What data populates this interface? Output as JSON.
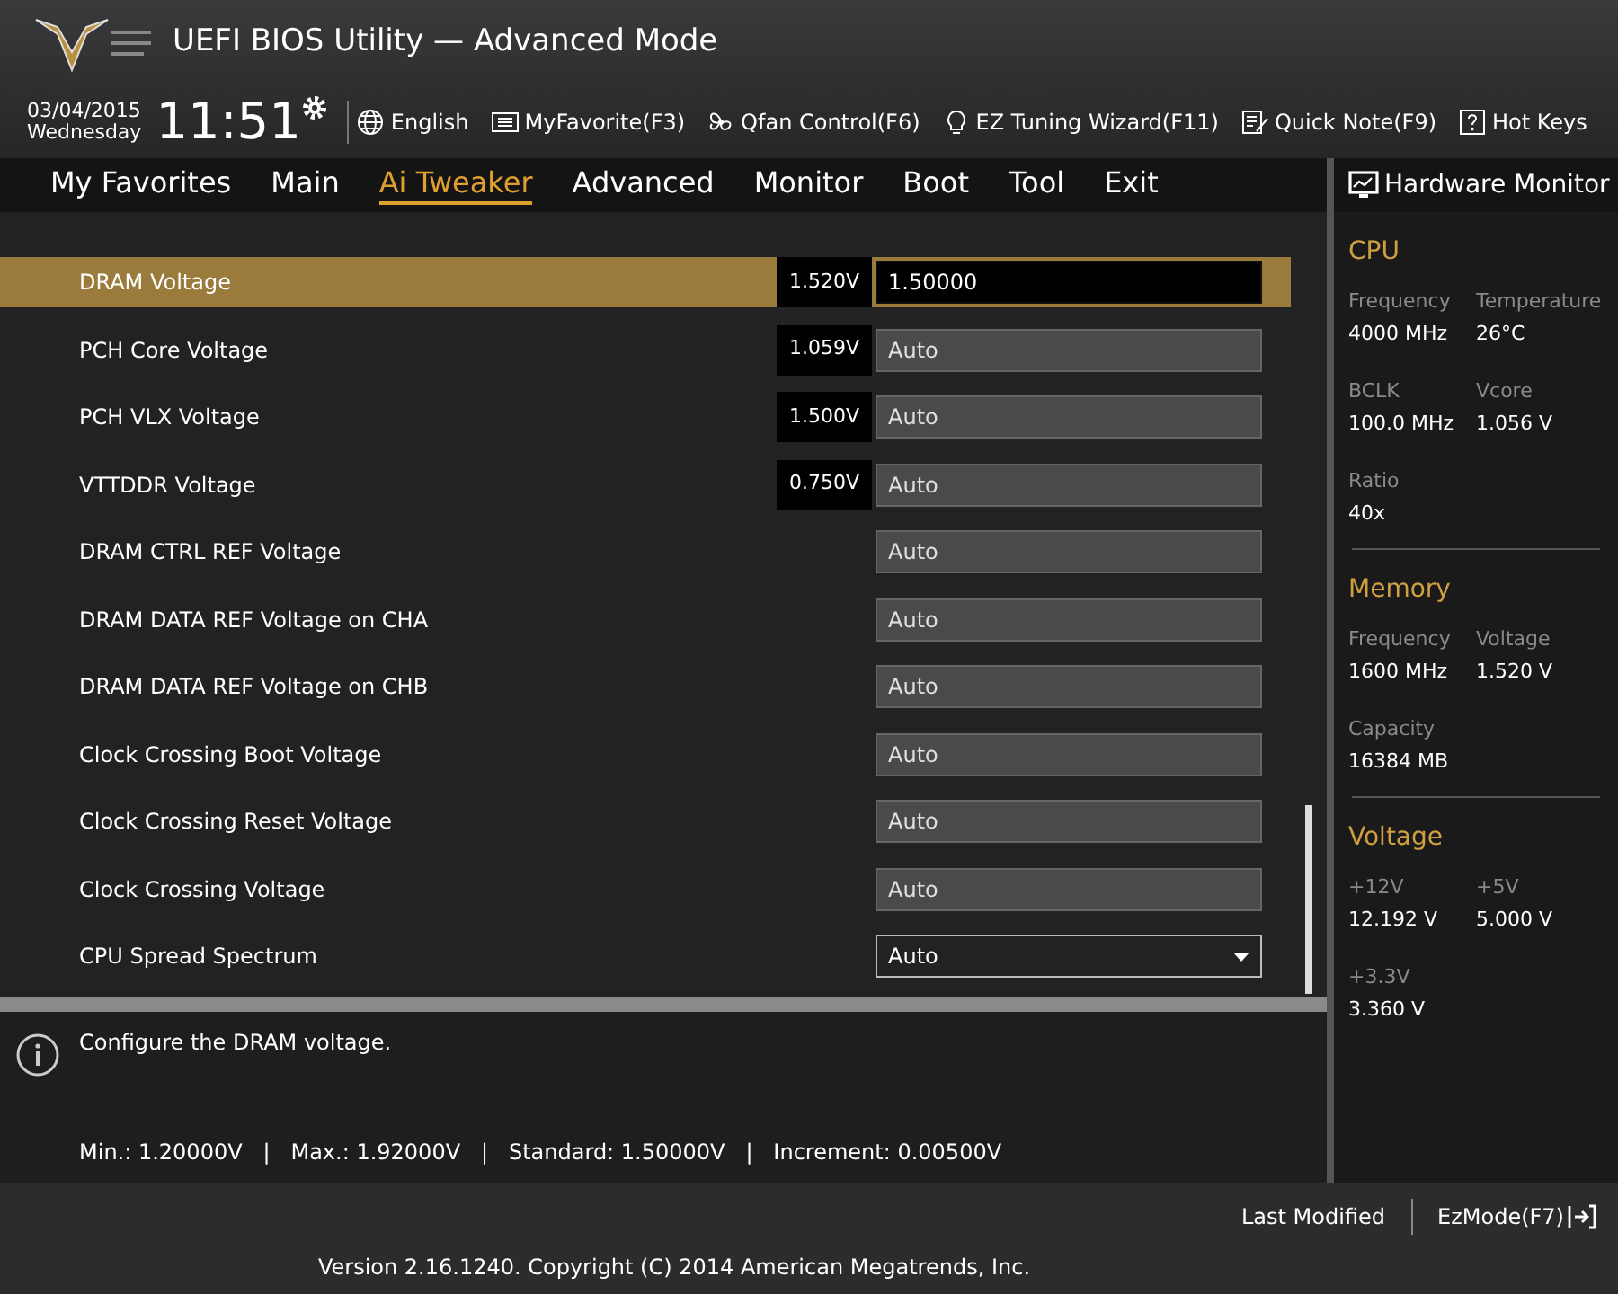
{
  "header": {
    "title": "UEFI BIOS Utility — Advanced Mode",
    "date": "03/04/2015",
    "weekday": "Wednesday",
    "time": "11:51",
    "tools": [
      {
        "kind": "globe",
        "label": "English"
      },
      {
        "kind": "favorite",
        "label": "MyFavorite(F3)"
      },
      {
        "kind": "fan",
        "label": "Qfan Control(F6)"
      },
      {
        "kind": "bulb",
        "label": "EZ Tuning Wizard(F11)"
      },
      {
        "kind": "note",
        "label": "Quick Note(F9)"
      },
      {
        "kind": "help",
        "label": "Hot Keys"
      }
    ]
  },
  "tabs": [
    {
      "label": "My Favorites",
      "selected": false
    },
    {
      "label": "Main",
      "selected": false
    },
    {
      "label": "Ai Tweaker",
      "selected": true
    },
    {
      "label": "Advanced",
      "selected": false
    },
    {
      "label": "Monitor",
      "selected": false
    },
    {
      "label": "Boot",
      "selected": false
    },
    {
      "label": "Tool",
      "selected": false
    },
    {
      "label": "Exit",
      "selected": false
    }
  ],
  "settings": [
    {
      "label": "DRAM Voltage",
      "reading": "1.520V",
      "value": "1.50000",
      "kind": "field",
      "selected": true
    },
    {
      "label": "PCH Core Voltage",
      "reading": "1.059V",
      "value": "Auto",
      "kind": "field",
      "selected": false
    },
    {
      "label": "PCH VLX Voltage",
      "reading": "1.500V",
      "value": "Auto",
      "kind": "field",
      "selected": false
    },
    {
      "label": "VTTDDR Voltage",
      "reading": "0.750V",
      "value": "Auto",
      "kind": "field",
      "selected": false
    },
    {
      "label": "DRAM CTRL REF Voltage",
      "value": "Auto",
      "kind": "field",
      "selected": false
    },
    {
      "label": "DRAM DATA REF Voltage on CHA",
      "value": "Auto",
      "kind": "field",
      "selected": false
    },
    {
      "label": "DRAM DATA REF Voltage on CHB",
      "value": "Auto",
      "kind": "field",
      "selected": false
    },
    {
      "label": "Clock Crossing Boot Voltage",
      "value": "Auto",
      "kind": "field",
      "selected": false
    },
    {
      "label": "Clock Crossing Reset Voltage",
      "value": "Auto",
      "kind": "field",
      "selected": false
    },
    {
      "label": "Clock Crossing Voltage",
      "value": "Auto",
      "kind": "field",
      "selected": false
    },
    {
      "label": "CPU Spread Spectrum",
      "value": "Auto",
      "kind": "dropdown",
      "selected": false
    }
  ],
  "help": {
    "text": "Configure the DRAM voltage.",
    "range": "Min.: 1.20000V   |   Max.: 1.92000V   |   Standard: 1.50000V   |   Increment: 0.00500V"
  },
  "hardware_monitor": {
    "title": "Hardware Monitor",
    "sections": [
      {
        "title": "CPU",
        "items": [
          {
            "label": "Frequency",
            "value": "4000 MHz"
          },
          {
            "label": "Temperature",
            "value": "26°C"
          },
          {
            "label": "BCLK",
            "value": "100.0 MHz"
          },
          {
            "label": "Vcore",
            "value": "1.056 V"
          },
          {
            "label": "Ratio",
            "value": "40x"
          }
        ]
      },
      {
        "title": "Memory",
        "items": [
          {
            "label": "Frequency",
            "value": "1600 MHz"
          },
          {
            "label": "Voltage",
            "value": "1.520 V"
          },
          {
            "label": "Capacity",
            "value": "16384 MB"
          }
        ]
      },
      {
        "title": "Voltage",
        "items": [
          {
            "label": "+12V",
            "value": "12.192 V"
          },
          {
            "label": "+5V",
            "value": "5.000 V"
          },
          {
            "label": "+3.3V",
            "value": "3.360 V"
          }
        ]
      }
    ]
  },
  "footer": {
    "last_modified": "Last Modified",
    "ezmode": "EzMode(F7)",
    "version": "Version 2.16.1240. Copyright (C) 2014 American Megatrends, Inc."
  }
}
